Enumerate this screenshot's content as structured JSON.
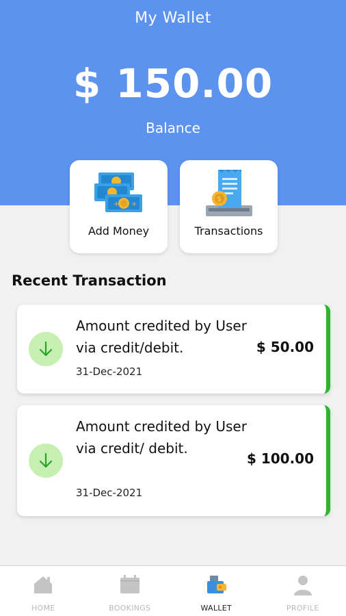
{
  "header": {
    "title": "My Wallet",
    "balance": "$ 150.00",
    "balance_label": "Balance"
  },
  "actions": {
    "add_money": "Add Money",
    "transactions": "Transactions"
  },
  "recent": {
    "title": "Recent Transaction",
    "items": [
      {
        "description": "Amount credited by User via credit/debit.",
        "date": "31-Dec-2021",
        "amount": "$ 50.00"
      },
      {
        "description": "Amount credited by User via credit/ debit.",
        "date": "31-Dec-2021",
        "amount": "$ 100.00"
      }
    ]
  },
  "nav": {
    "items": [
      {
        "label": "HOME",
        "icon": "home-icon"
      },
      {
        "label": "BOOKINGS",
        "icon": "calendar-icon"
      },
      {
        "label": "WALLET",
        "icon": "wallet-icon"
      },
      {
        "label": "PROFILE",
        "icon": "person-icon"
      }
    ],
    "active": "WALLET"
  },
  "colors": {
    "header": "#5b93ef",
    "credit_accent": "#2bb52b",
    "credit_icon_bg": "#c6efb1"
  }
}
